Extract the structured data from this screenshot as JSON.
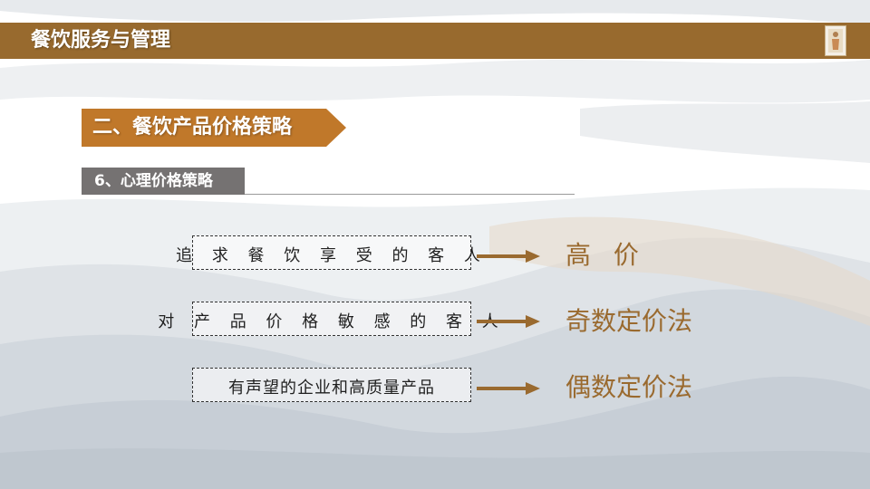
{
  "header": {
    "title": "餐饮服务与管理"
  },
  "section": {
    "title": "二、餐饮产品价格策略"
  },
  "subsection": {
    "title": "6、心理价格策略"
  },
  "rows": [
    {
      "customer": "追 求 餐 饮 享 受 的 客 人",
      "strategy": "高 价"
    },
    {
      "customer": "对 产 品 价 格 敏 感 的 客 人",
      "strategy": "奇数定价法"
    },
    {
      "customer": "有声望的企业和高质量产品",
      "strategy": "偶数定价法"
    }
  ],
  "colors": {
    "header_bar": "#986a2e",
    "accent_orange": "#c0782a",
    "result_text": "#9a6a2f",
    "sub_tag": "#757272"
  }
}
